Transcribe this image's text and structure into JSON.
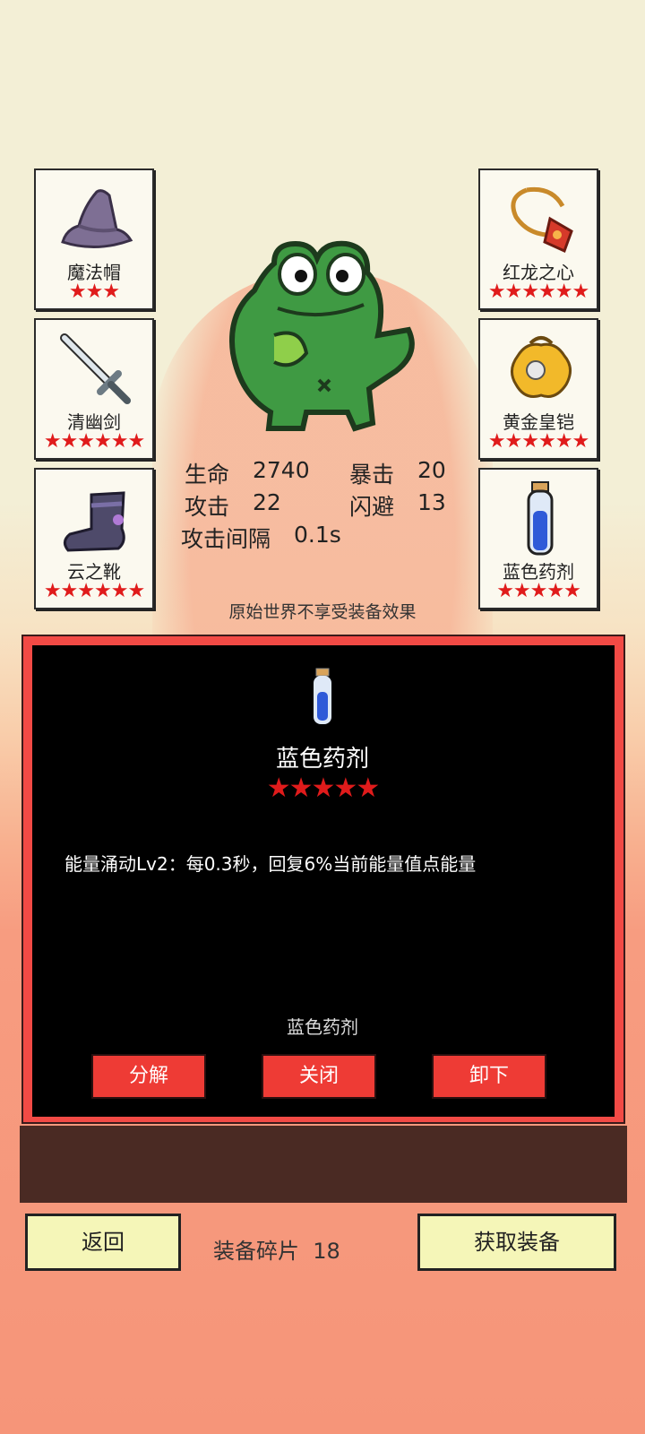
{
  "slots_left": [
    {
      "name": "魔法帽",
      "stars": "★★★",
      "icon": "wizard-hat"
    },
    {
      "name": "清幽剑",
      "stars": "★★★★★★",
      "icon": "sword"
    },
    {
      "name": "云之靴",
      "stars": "★★★★★★",
      "icon": "boot"
    }
  ],
  "slots_right": [
    {
      "name": "红龙之心",
      "stars": "★★★★★★",
      "icon": "amulet"
    },
    {
      "name": "黄金皇铠",
      "stars": "★★★★★★",
      "icon": "golden-armor"
    },
    {
      "name": "蓝色药剂",
      "stars": "★★★★★",
      "icon": "blue-potion"
    }
  ],
  "character": {
    "icon": "frog"
  },
  "stats": {
    "hp_label": "生命",
    "hp": "2740",
    "crit_label": "暴击",
    "crit": "20",
    "atk_label": "攻击",
    "atk": "22",
    "dodge_label": "闪避",
    "dodge": "13",
    "interval_label": "攻击间隔",
    "interval": "0.1s"
  },
  "note": "原始世界不享受装备效果",
  "panel": {
    "title": "蓝色药剂",
    "stars": "★★★★★",
    "description": "能量涌动Lv2：每0.3秒，回复6%当前能量值点能量",
    "subtitle": "蓝色药剂",
    "buttons": {
      "decompose": "分解",
      "close": "关闭",
      "unequip": "卸下"
    }
  },
  "footer": {
    "back": "返回",
    "fragments_label": "装备碎片",
    "fragments": "18",
    "get_equipment": "获取装备"
  },
  "colors": {
    "accent_red": "#ee3b35",
    "star": "#e01b1b",
    "panel_border": "#f24a45",
    "button_yellow": "#f5f6b8"
  }
}
